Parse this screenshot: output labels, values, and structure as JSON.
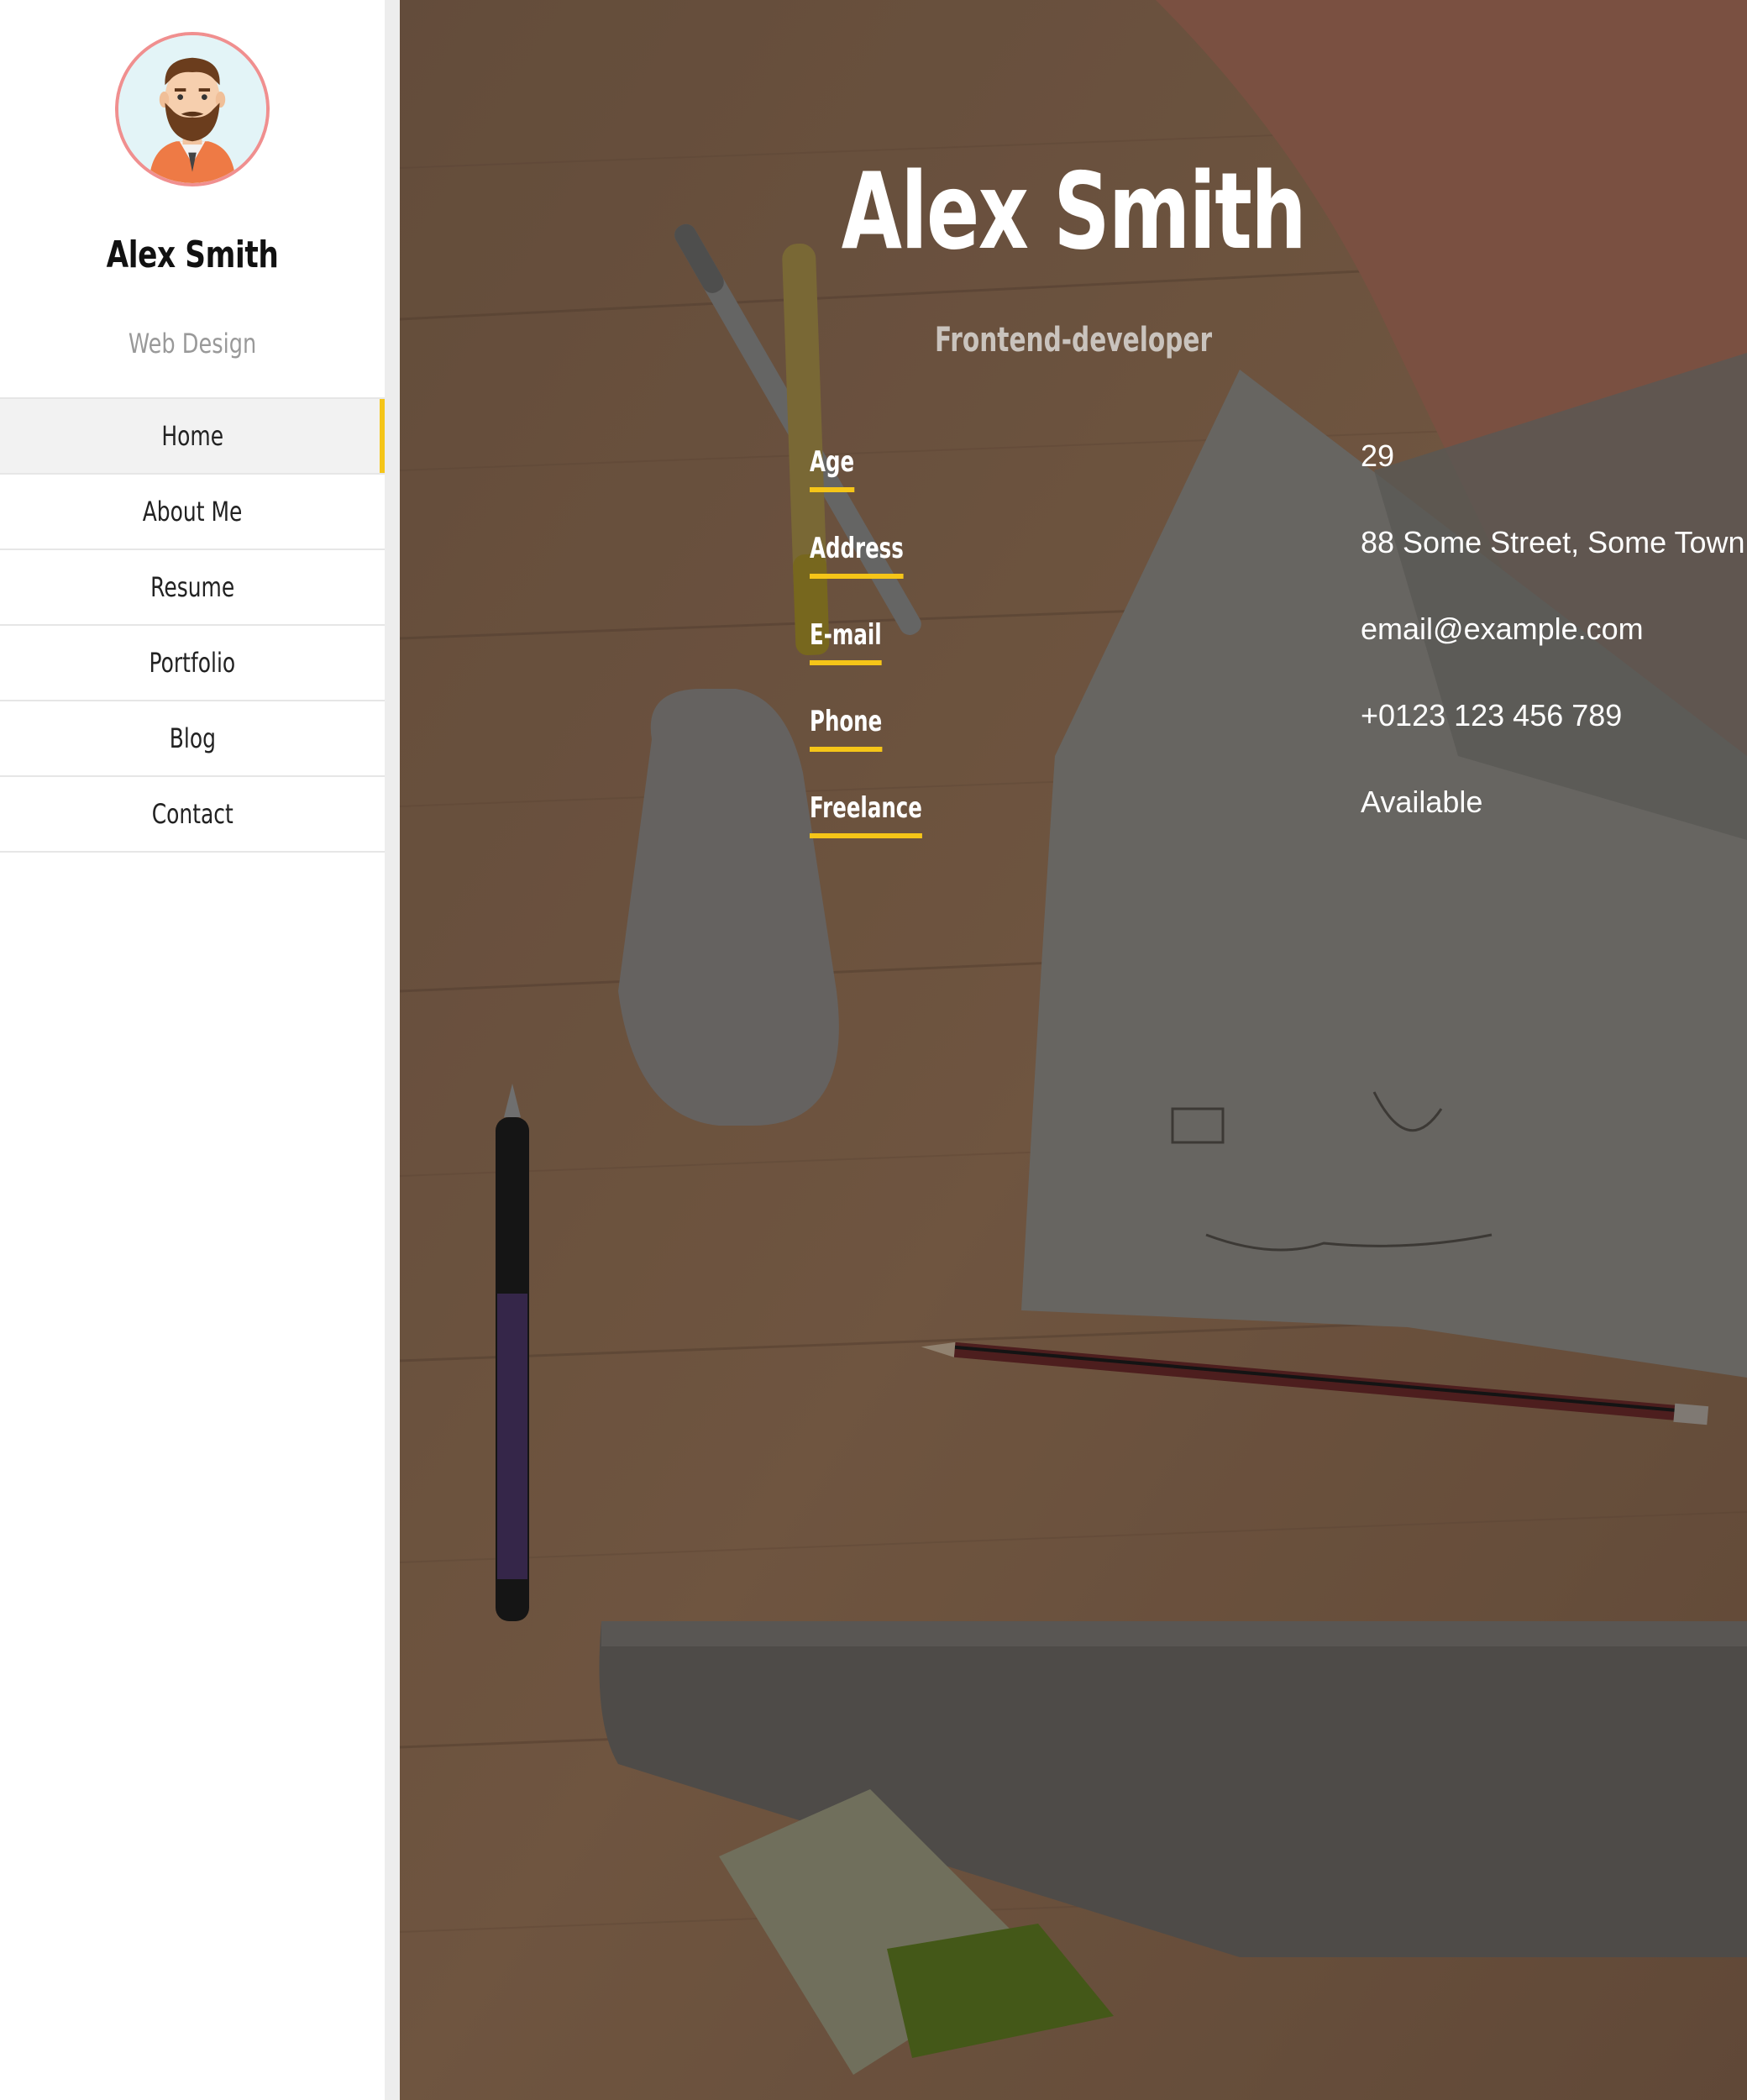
{
  "sidebar": {
    "name": "Alex Smith",
    "role": "Web Design",
    "nav": [
      {
        "label": "Home",
        "active": true
      },
      {
        "label": "About Me"
      },
      {
        "label": "Resume"
      },
      {
        "label": "Portfolio"
      },
      {
        "label": "Blog"
      },
      {
        "label": "Contact"
      }
    ]
  },
  "hero": {
    "name": "Alex Smith",
    "role": "Frontend-developer"
  },
  "info": [
    {
      "label": "Age",
      "value": "29"
    },
    {
      "label": "Address",
      "value": "88 Some Street, Some Town"
    },
    {
      "label": "E-mail",
      "value": "email@example.com"
    },
    {
      "label": "Phone",
      "value": "+0123 123 456 789"
    },
    {
      "label": "Freelance",
      "value": "Available"
    }
  ],
  "colors": {
    "accent": "#f5c518",
    "avatar_border": "#f08f8f"
  }
}
